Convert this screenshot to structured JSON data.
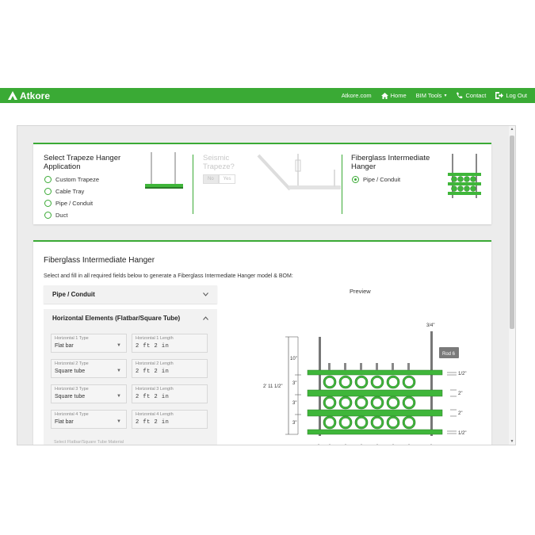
{
  "header": {
    "brand": "Atkore",
    "nav": [
      {
        "label": "Atkore.com",
        "icon": ""
      },
      {
        "label": "Home",
        "icon": "home-icon"
      },
      {
        "label": "BIM Tools",
        "icon": "",
        "dropdown": "▾"
      },
      {
        "label": "Contact",
        "icon": "phone-icon"
      },
      {
        "label": "Log Out",
        "icon": "logout-icon"
      }
    ]
  },
  "selector": {
    "section1": {
      "title": "Select Trapeze Hanger Application",
      "options": [
        "Custom Trapeze",
        "Cable Tray",
        "Pipe / Conduit",
        "Duct"
      ]
    },
    "section2": {
      "title": "Seismic Trapeze?",
      "no": "No",
      "yes": "Yes"
    },
    "section3": {
      "title": "Fiberglass Intermediate Hanger",
      "option": "Pipe / Conduit",
      "selected": true
    }
  },
  "config": {
    "title": "Fiberglass Intermediate Hanger",
    "instructions": "Select and fill in all required fields below to generate a Fiberglass Intermediate Hanger model & BOM:",
    "accordion1": "Pipe / Conduit",
    "accordion2": "Horizontal Elements (Flatbar/Square Tube)",
    "fields": [
      {
        "type_label": "Horizontal 1 Type",
        "type_value": "Flat bar",
        "len_label": "Horizontal 1 Length",
        "len_value": "2 ft 2 in"
      },
      {
        "type_label": "Horizontal 2 Type",
        "type_value": "Square tube",
        "len_label": "Horizontal 2 Length",
        "len_value": "2 ft 2 in"
      },
      {
        "type_label": "Horizontal 3 Type",
        "type_value": "Square tube",
        "len_label": "Horizontal 3 Length",
        "len_value": "2 ft 2 in"
      },
      {
        "type_label": "Horizontal 4 Type",
        "type_value": "Flat bar",
        "len_label": "Horizontal 4 Length",
        "len_value": "2 ft 2 in"
      }
    ],
    "more_label": "Select Flatbar/Square Tube Material",
    "preview_label": "Preview",
    "preview": {
      "rod_label": "Rod 6",
      "dim_top": "3/4\"",
      "dim_rod": "10\"",
      "dim_total": "2' 11 1/2\"",
      "dim_gap1": "3\"",
      "dim_gap2": "3\"",
      "dim_gap3": "3\"",
      "dim_r1": "1/2\"",
      "dim_r2": "2\"",
      "dim_r3": "2\"",
      "dim_r4": "1/2\""
    }
  },
  "colors": {
    "accent": "#3aaa35",
    "pipe": "#3fb63a",
    "rod": "#777777"
  }
}
